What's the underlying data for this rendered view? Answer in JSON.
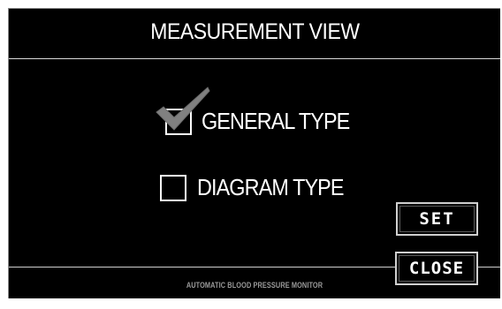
{
  "window": {
    "title": "MEASUREMENT VIEW"
  },
  "options": [
    {
      "label": "GENERAL TYPE",
      "checked": true
    },
    {
      "label": "DIAGRAM TYPE",
      "checked": false
    }
  ],
  "buttons": {
    "set_label": "SET",
    "close_label": "CLOSE"
  },
  "footer": {
    "text": "AUTOMATIC BLOOD PRESSURE MONITOR"
  },
  "colors": {
    "background": "#000000",
    "text": "#ffffff",
    "checkmark": "#808080",
    "footer_text": "#9a9a9a"
  },
  "icons": {
    "check": "check-icon"
  }
}
